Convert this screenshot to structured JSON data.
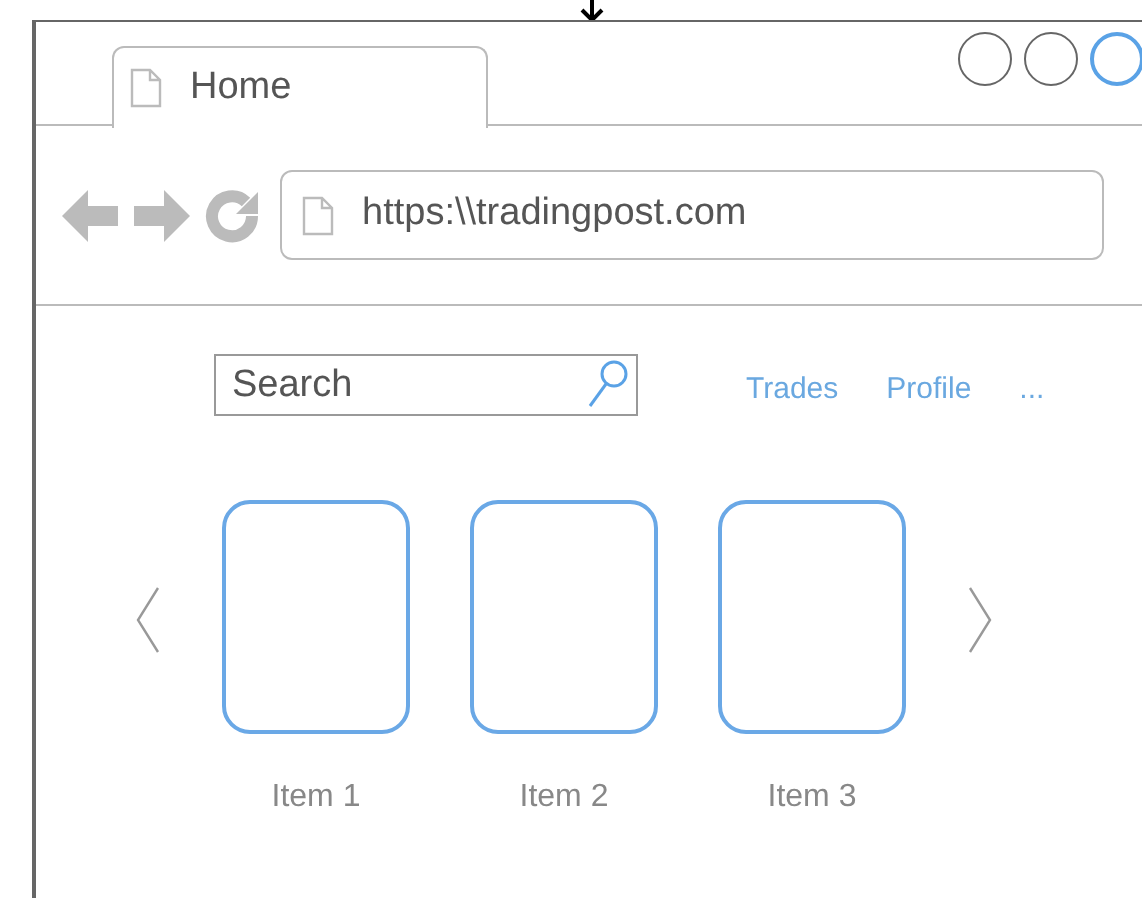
{
  "tab": {
    "label": "Home"
  },
  "window_controls": [
    {
      "selected": false
    },
    {
      "selected": false
    },
    {
      "selected": true
    }
  ],
  "address_bar": {
    "value": "https:\\\\tradingpost.com"
  },
  "search": {
    "placeholder": "Search"
  },
  "nav_links": [
    "Trades",
    "Profile",
    "..."
  ],
  "items": [
    {
      "label": "Item 1"
    },
    {
      "label": "Item 2"
    },
    {
      "label": "Item 3"
    }
  ]
}
